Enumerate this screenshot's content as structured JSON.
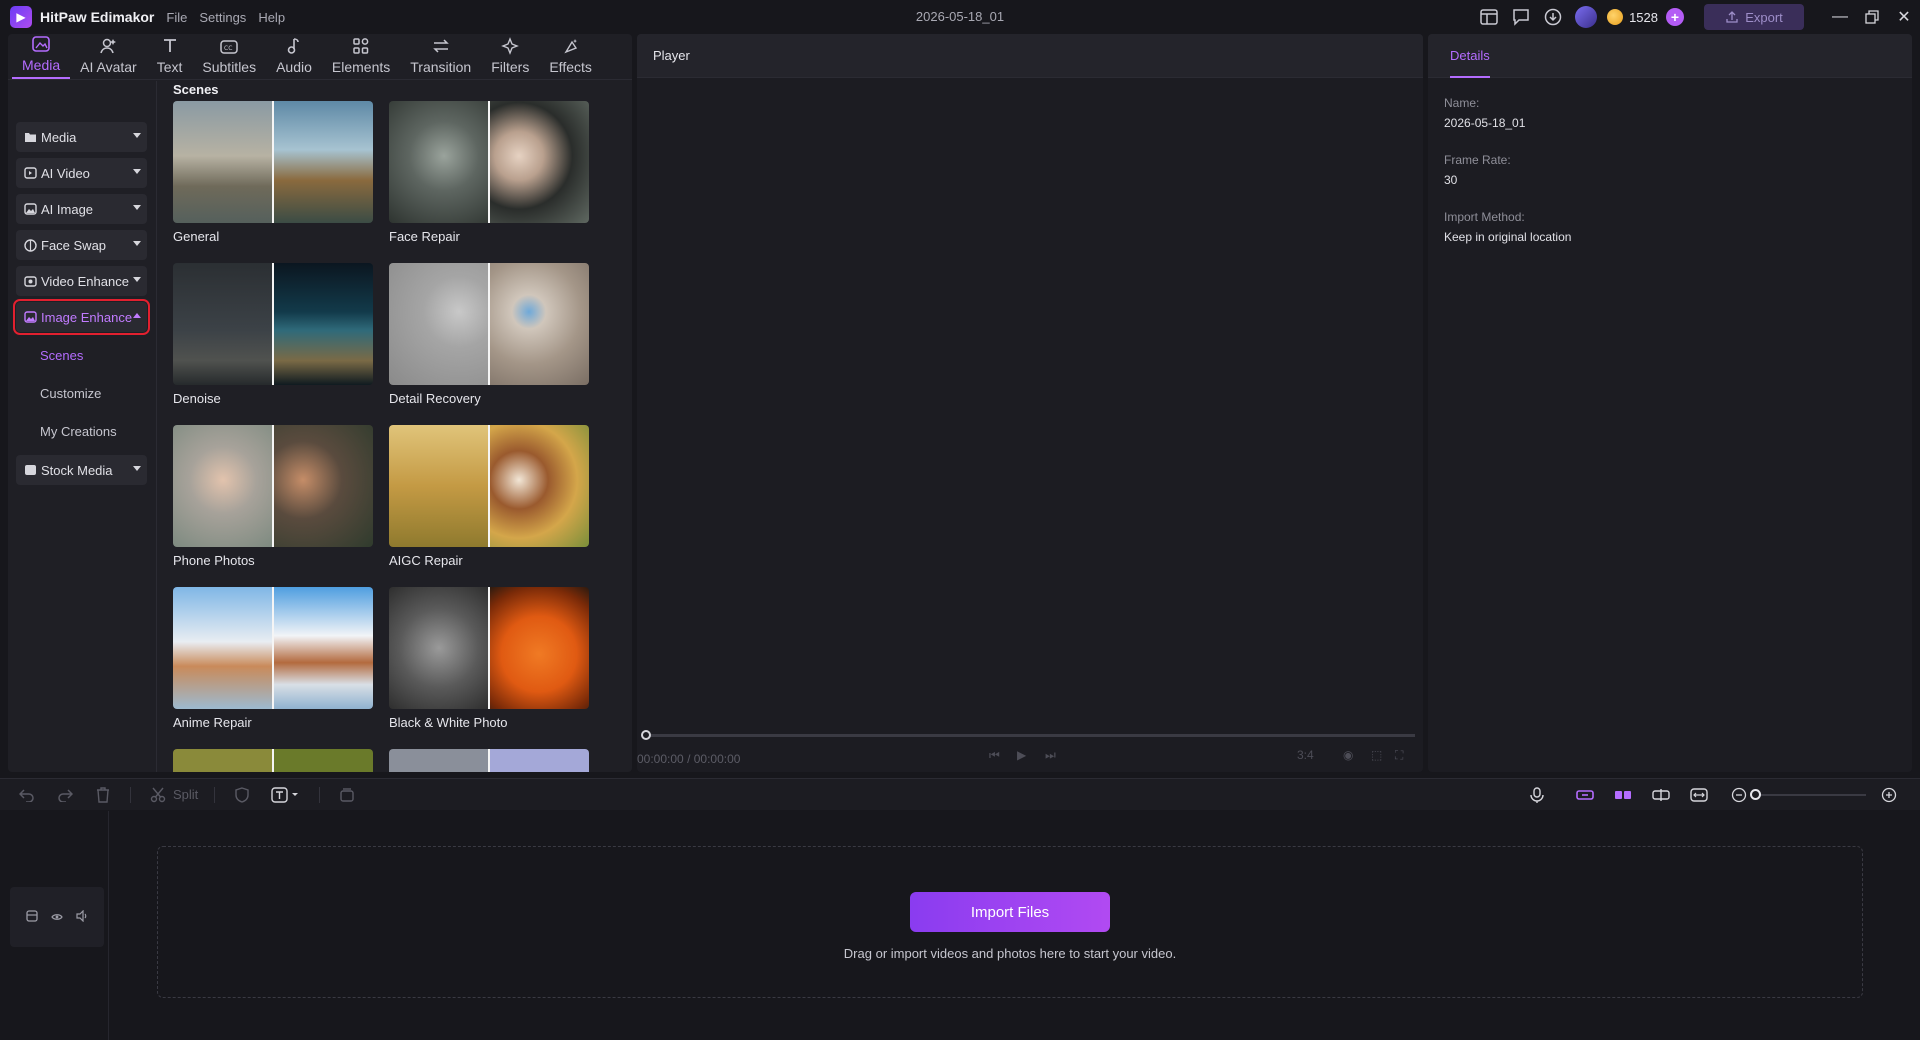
{
  "titlebar": {
    "app_name": "HitPaw Edimakor",
    "menu": [
      "File",
      "Settings",
      "Help"
    ],
    "project_title": "2026-05-18_01",
    "coins": "1528",
    "export_label": "Export"
  },
  "tabs": [
    {
      "label": "Media",
      "icon": "media-icon"
    },
    {
      "label": "AI Avatar",
      "icon": "ai-avatar-icon"
    },
    {
      "label": "Text",
      "icon": "text-icon"
    },
    {
      "label": "Subtitles",
      "icon": "subtitles-icon"
    },
    {
      "label": "Audio",
      "icon": "audio-icon"
    },
    {
      "label": "Elements",
      "icon": "elements-icon"
    },
    {
      "label": "Transition",
      "icon": "transition-icon"
    },
    {
      "label": "Filters",
      "icon": "filters-icon"
    },
    {
      "label": "Effects",
      "icon": "effects-icon"
    }
  ],
  "categories": {
    "media": "Media",
    "ai_video": "AI Video",
    "ai_image": "AI Image",
    "face_swap": "Face Swap",
    "video_enhance": "Video Enhance",
    "image_enhance": "Image Enhance",
    "stock_media": "Stock Media"
  },
  "subcategories": {
    "scenes": "Scenes",
    "customize": "Customize",
    "my_creations": "My Creations"
  },
  "scenes": {
    "heading": "Scenes",
    "cards": [
      "General",
      "Face Repair",
      "Denoise",
      "Detail Recovery",
      "Phone Photos",
      "AIGC Repair",
      "Anime Repair",
      "Black & White Photo"
    ]
  },
  "player": {
    "title": "Player",
    "time_current": "00:00:00",
    "time_total": "/ 00:00:00",
    "ratio": "3:4"
  },
  "details": {
    "tab": "Details",
    "name_label": "Name:",
    "name_value": "2026-05-18_01",
    "frame_rate_label": "Frame Rate:",
    "frame_rate_value": "30",
    "import_method_label": "Import Method:",
    "import_method_value": "Keep in original location"
  },
  "timeline": {
    "split_label": "Split",
    "import_button": "Import Files",
    "drag_hint": "Drag or import videos and photos here to start your video."
  },
  "colors": {
    "accent": "#b46cff",
    "highlight_border": "#e2202f",
    "background": "#17171c"
  }
}
